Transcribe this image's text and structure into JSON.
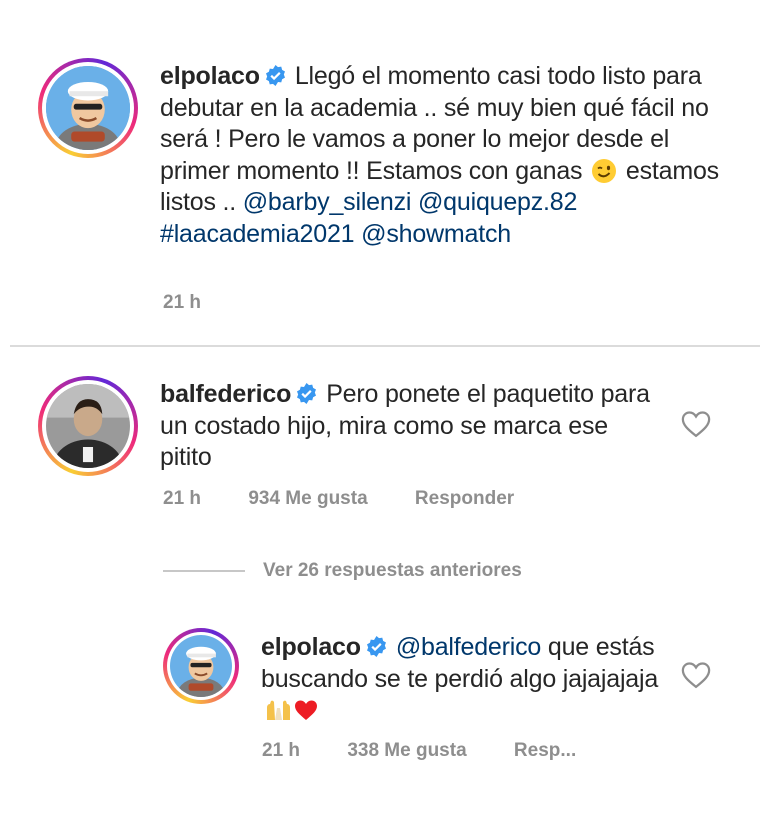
{
  "post": {
    "username": "elpolaco",
    "text": "Llegó el momento casi todo listo para debutar en la academia .. sé muy bien qué fácil no será ! Pero le vamos a poner lo mejor desde el primer momento !! Estamos con ganas",
    "text_after_emoji": "estamos listos ..",
    "mentions": [
      "@barby_silenzi",
      "@quiquepz.82"
    ],
    "hashtag": "#laacademia2021",
    "mention_last": "@showmatch",
    "time": "21 h"
  },
  "comment": {
    "username": "balfederico",
    "text": "Pero ponete el paquetito para un costado hijo, mira como se marca ese pitito",
    "time": "21 h",
    "likes": "934 Me gusta",
    "reply_label": "Responder"
  },
  "view_replies": "Ver 26 respuestas anteriores",
  "reply": {
    "username": "elpolaco",
    "mention": "@balfederico",
    "text": "que estás buscando se te perdió algo jajajajaja",
    "time": "21 h",
    "likes": "338 Me gusta",
    "reply_label": "Resp..."
  },
  "icons": {
    "verified": "verified-badge-icon",
    "like": "heart-icon",
    "wink_emoji": "winking-face-emoji",
    "hands_emoji": "raised-hands-emoji",
    "heart_emoji": "red-heart-emoji"
  },
  "colors": {
    "verified": "#3897f0",
    "mention": "#00376b",
    "meta": "#8e8e8e",
    "heart_emoji": "#ed1c24"
  }
}
